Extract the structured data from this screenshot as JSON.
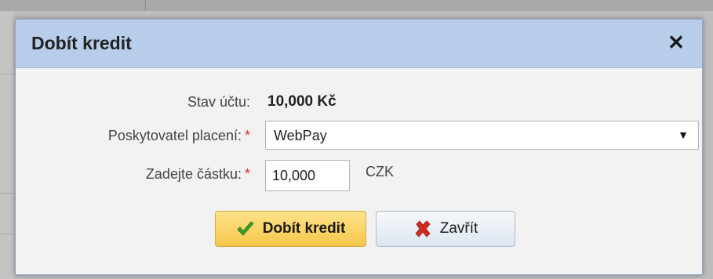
{
  "dialog": {
    "title": "Dobít kredit",
    "close_symbol": "✕"
  },
  "form": {
    "balance_label": "Stav účtu:",
    "balance_value": "10,000 Kč",
    "provider_label": "Poskytovatel placení:",
    "provider_value": "WebPay",
    "amount_label": "Zadejte částku:",
    "amount_value": "10,000",
    "currency": "CZK",
    "required_mark": "*"
  },
  "buttons": {
    "submit_label": "Dobít kredit",
    "submit_icon": "check-icon",
    "close_label": "Zavřít",
    "close_icon": "x-icon"
  },
  "colors": {
    "header_bg": "#b8cde9",
    "primary_button": "#f7c74a",
    "required": "#d33333",
    "check_icon": "#3aa12c",
    "x_icon": "#d12a1e"
  }
}
